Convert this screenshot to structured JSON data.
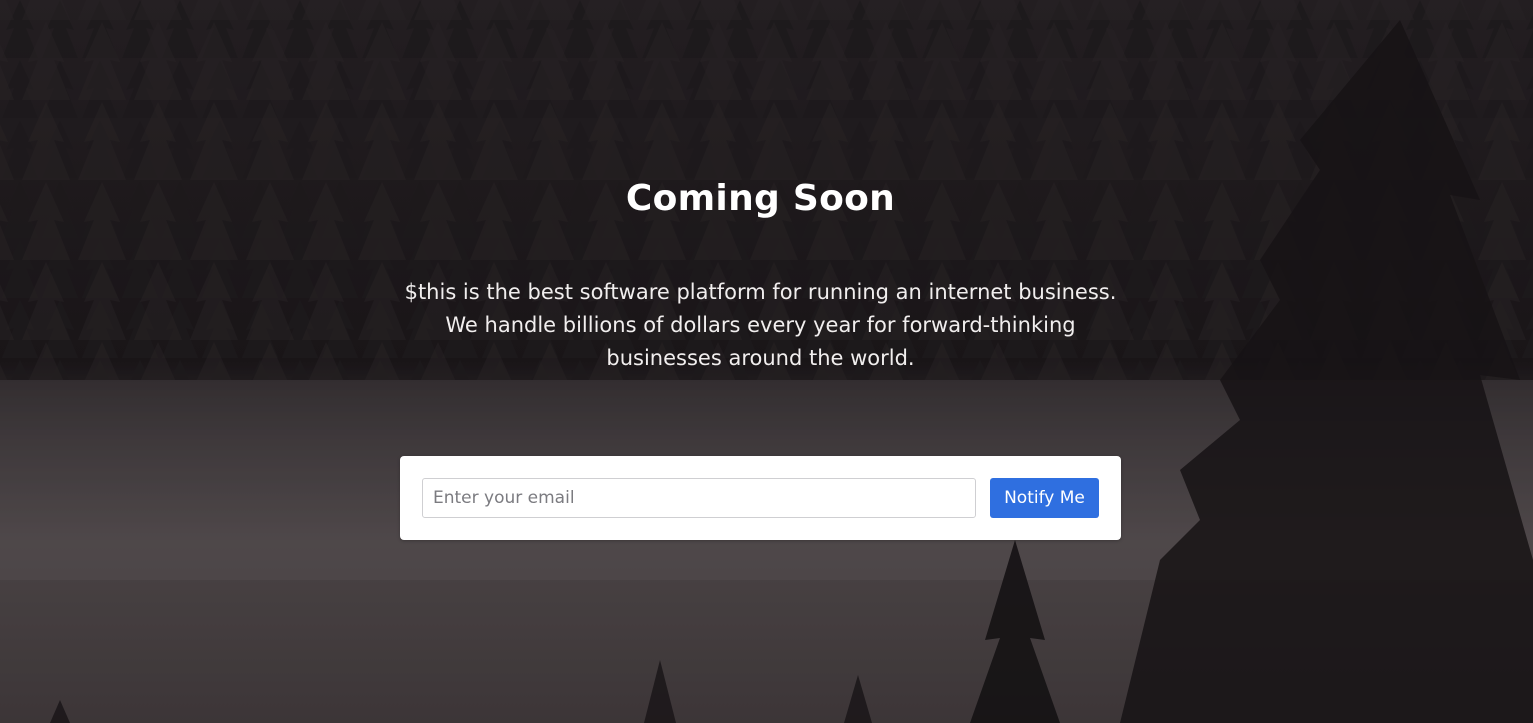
{
  "hero": {
    "title": "Coming Soon",
    "description_lines": [
      "$this is the best software platform for running an internet business.",
      "We handle billions of dollars every year for forward-thinking",
      "businesses around the world."
    ]
  },
  "signup": {
    "email_placeholder": "Enter your email",
    "email_value": "",
    "button_label": "Notify Me"
  },
  "colors": {
    "accent": "#2f6fe0",
    "background": "#2a2528",
    "text": "#ffffff"
  }
}
